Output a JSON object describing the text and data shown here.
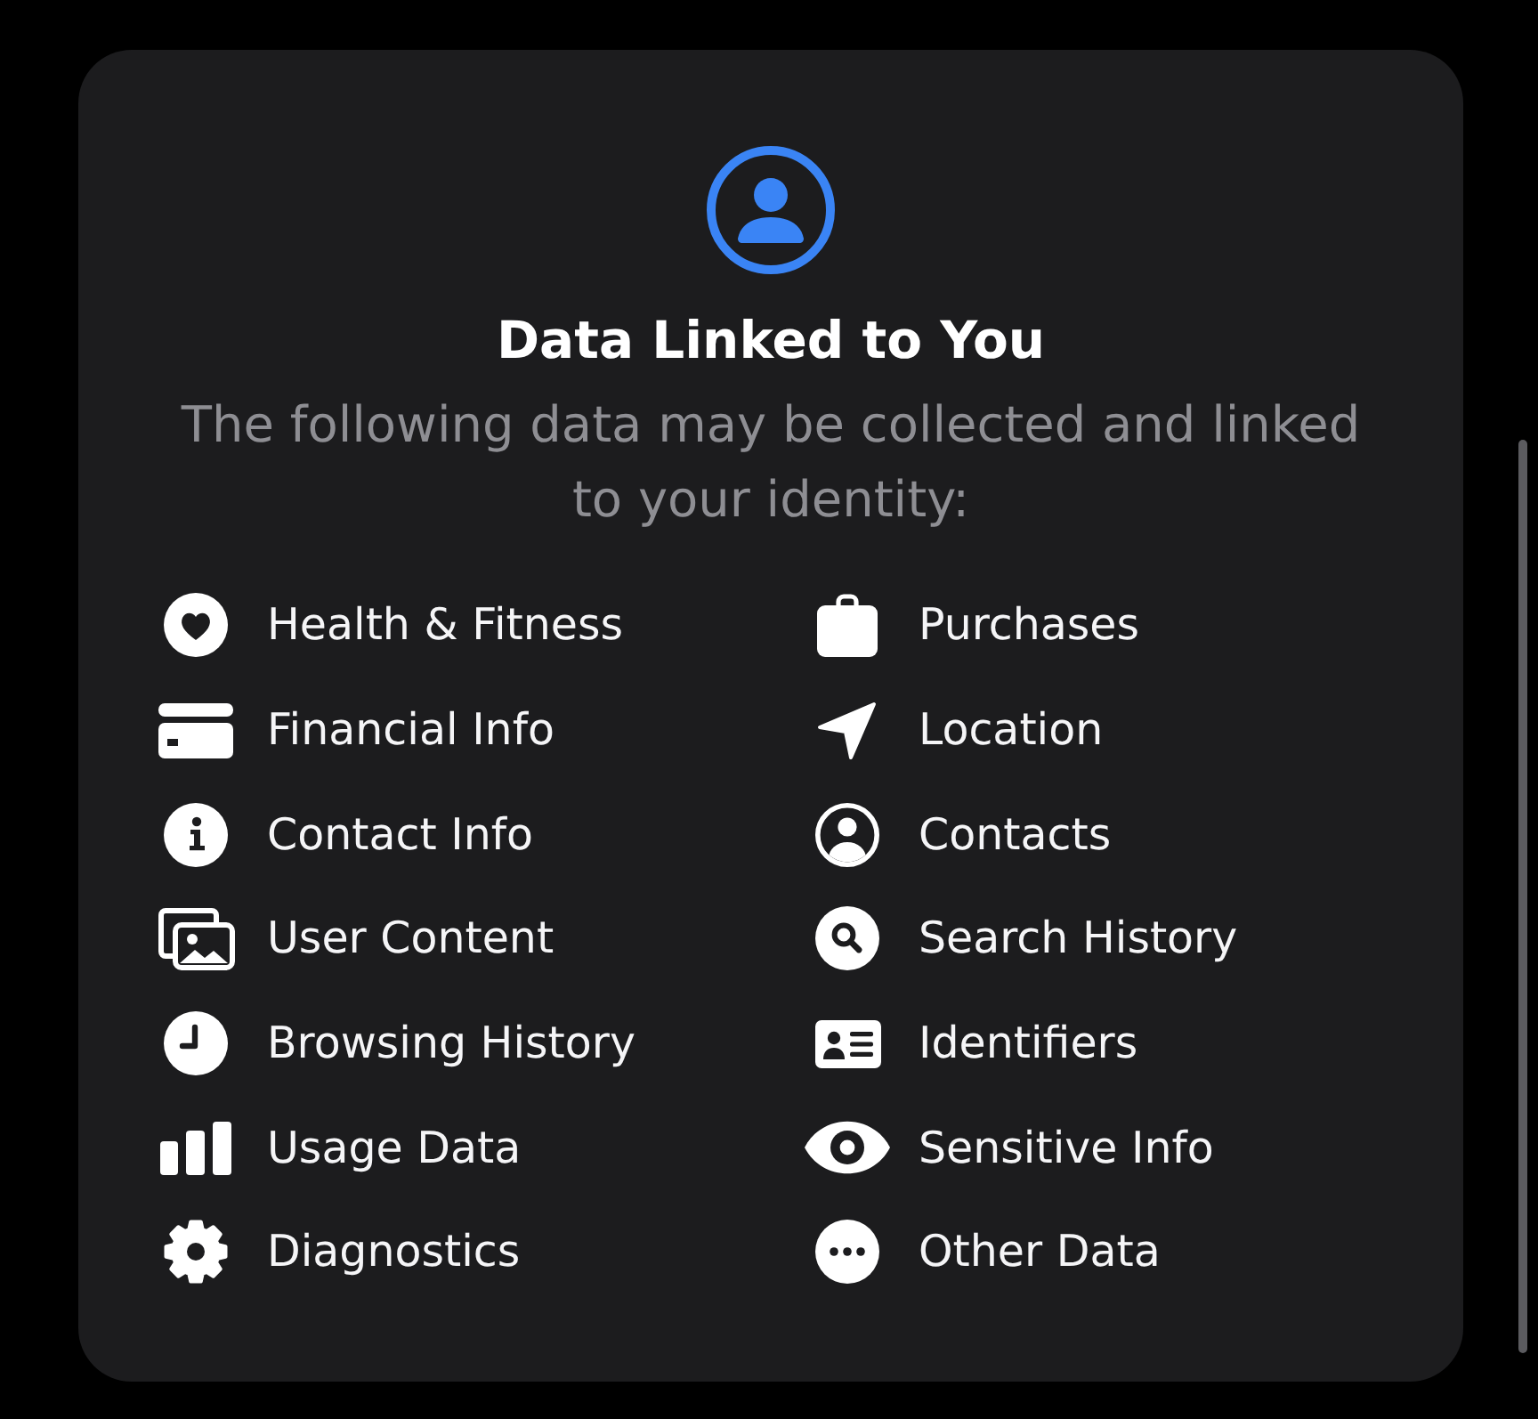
{
  "header": {
    "title": "Data Linked to You",
    "subtitle": "The following data may be collected and linked to your identity:"
  },
  "categories": [
    "Health & Fitness",
    "Purchases",
    "Financial Info",
    "Location",
    "Contact Info",
    "Contacts",
    "User Content",
    "Search History",
    "Browsing History",
    "Identifiers",
    "Usage Data",
    "Sensitive Info",
    "Diagnostics",
    "Other Data"
  ]
}
